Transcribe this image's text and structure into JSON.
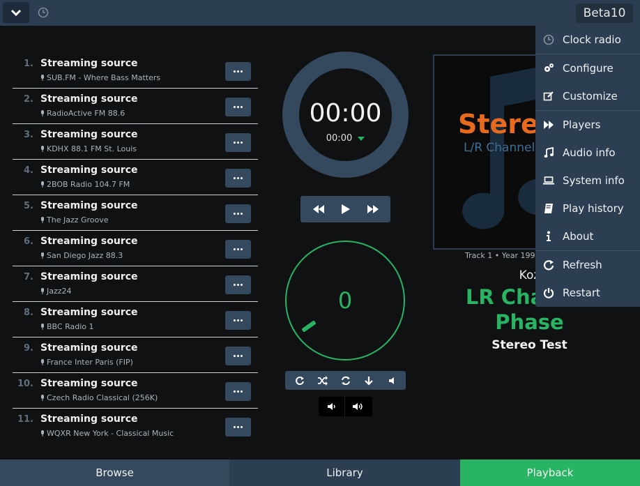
{
  "header": {
    "version": "Beta10"
  },
  "queue": [
    {
      "num": "1.",
      "title": "Streaming source",
      "station": "SUB.FM - Where Bass Matters"
    },
    {
      "num": "2.",
      "title": "Streaming source",
      "station": "RadioActive FM 88.6"
    },
    {
      "num": "3.",
      "title": "Streaming source",
      "station": "KDHX 88.1 FM St. Louis"
    },
    {
      "num": "4.",
      "title": "Streaming source",
      "station": "2BOB Radio 104.7 FM"
    },
    {
      "num": "5.",
      "title": "Streaming source",
      "station": "The Jazz Groove"
    },
    {
      "num": "6.",
      "title": "Streaming source",
      "station": "San Diego Jazz 88.3"
    },
    {
      "num": "7.",
      "title": "Streaming source",
      "station": "Jazz24"
    },
    {
      "num": "8.",
      "title": "Streaming source",
      "station": "BBC Radio 1"
    },
    {
      "num": "9.",
      "title": "Streaming source",
      "station": "France Inter Paris (FIP)"
    },
    {
      "num": "10.",
      "title": "Streaming source",
      "station": "Czech Radio Classical (256K)"
    },
    {
      "num": "11.",
      "title": "Streaming source",
      "station": "WQXR New York - Classical Music"
    }
  ],
  "playback": {
    "elapsed": "00:00",
    "duration": "00:00",
    "volume": "0"
  },
  "now_playing": {
    "cover_text_1": "Stereo",
    "cover_text_2": "L/R Channel",
    "meta": "Track 1 • Year 1997",
    "artist": "Koz",
    "title": "LR Channel Phase",
    "album": "Stereo Test"
  },
  "menu": [
    {
      "label": "Clock radio",
      "icon": "clock-icon"
    },
    {
      "label": "Configure",
      "icon": "cogs-icon"
    },
    {
      "label": "Customize",
      "icon": "edit-icon"
    },
    {
      "label": "Players",
      "icon": "fast-forward-icon"
    },
    {
      "label": "Audio info",
      "icon": "music-note-icon"
    },
    {
      "label": "System info",
      "icon": "laptop-icon"
    },
    {
      "label": "Play history",
      "icon": "book-icon"
    },
    {
      "label": "About",
      "icon": "info-icon"
    },
    {
      "label": "Refresh",
      "icon": "refresh-icon"
    },
    {
      "label": "Restart",
      "icon": "power-icon"
    }
  ],
  "tabs": {
    "browse": "Browse",
    "library": "Library",
    "playback": "Playback"
  },
  "colors": {
    "accent": "#28b463",
    "panel": "#34495e",
    "header": "#2c3e52"
  }
}
